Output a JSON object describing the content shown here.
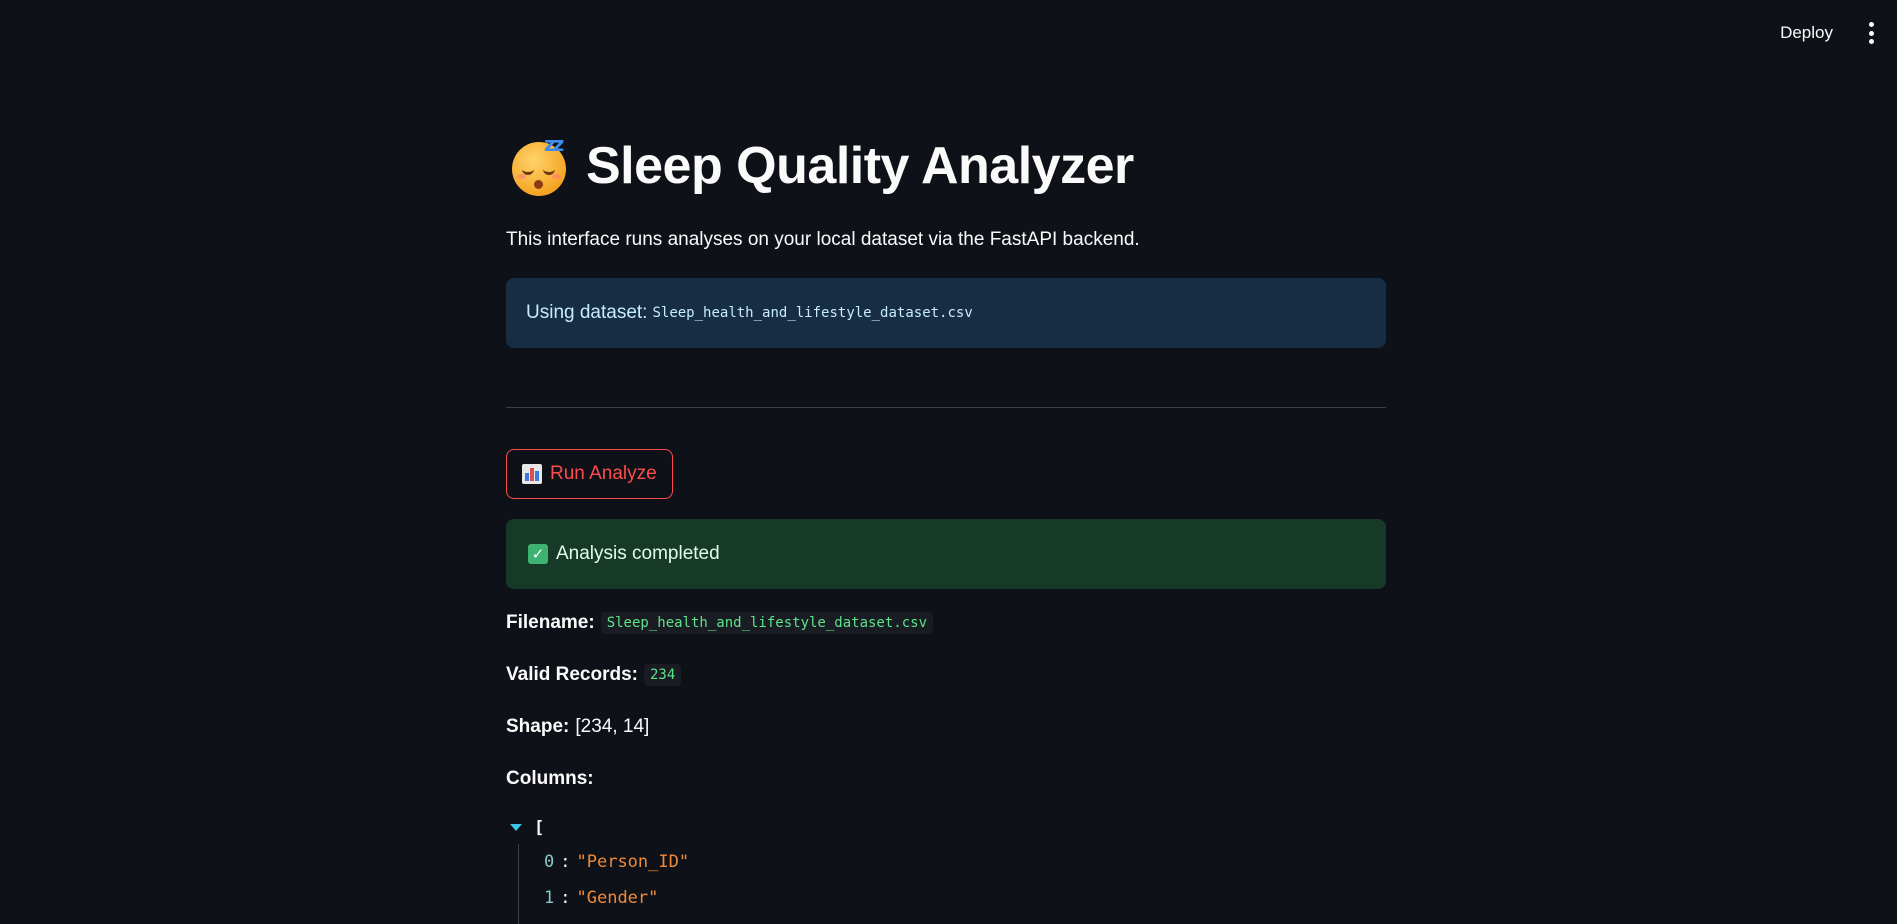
{
  "header": {
    "deploy_label": "Deploy",
    "menu_icon": "more-vertical-icon"
  },
  "page": {
    "title": "Sleep Quality Analyzer",
    "title_icon": "sleeping-face-icon",
    "subtitle": "This interface runs analyses on your local dataset via the FastAPI backend.",
    "info": {
      "label": "Using dataset:",
      "dataset": "Sleep_health_and_lifestyle_dataset.csv"
    },
    "run_button": {
      "icon": "bar-chart-icon",
      "label": "Run Analyze"
    },
    "success": {
      "icon": "check-mark-icon",
      "message": "Analysis completed"
    },
    "results": {
      "filename_label": "Filename:",
      "filename": "Sleep_health_and_lifestyle_dataset.csv",
      "valid_records_label": "Valid Records:",
      "valid_records": "234",
      "shape_label": "Shape:",
      "shape": "[234, 14]",
      "columns_label": "Columns:",
      "columns_open": "[",
      "columns": [
        {
          "index": "0",
          "value": "\"Person_ID\""
        },
        {
          "index": "1",
          "value": "\"Gender\""
        }
      ]
    }
  },
  "colors": {
    "background": "#0e1117",
    "accent": "#ff4b4b",
    "info_bg": "#172d43",
    "success_bg": "#173928",
    "code_green": "#5ce488",
    "json_string": "#f08a3a"
  }
}
